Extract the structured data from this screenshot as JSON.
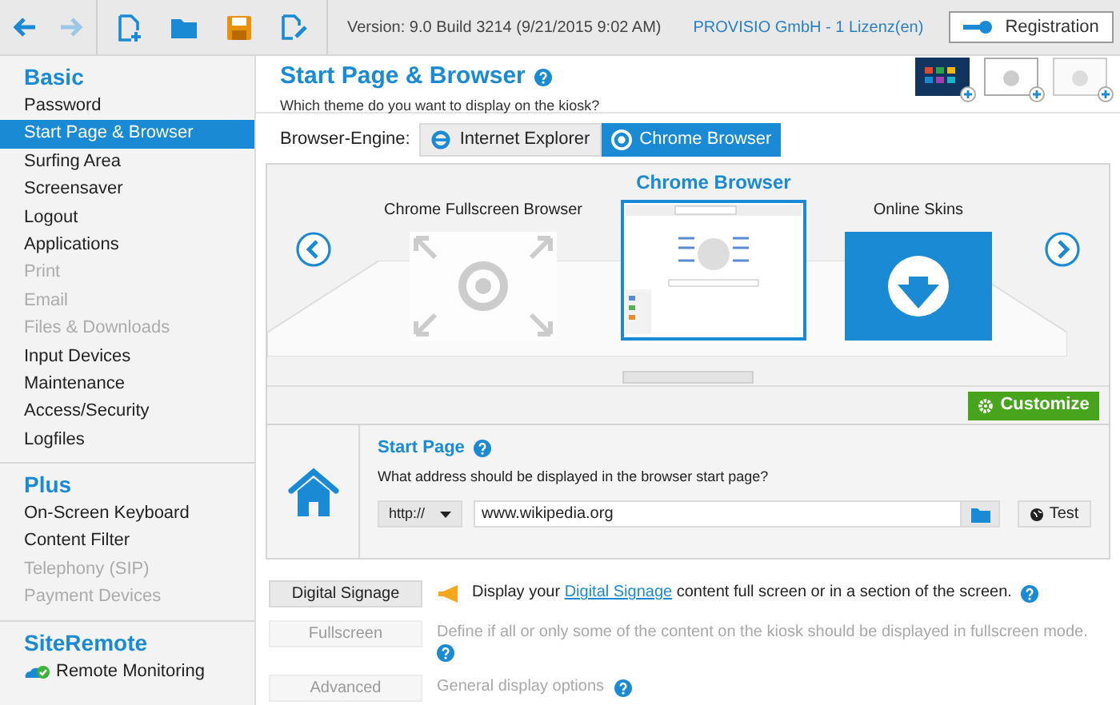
{
  "toolbar": {
    "nav": [
      {
        "kind": "back",
        "disabled": false
      },
      {
        "kind": "forward",
        "disabled": true
      }
    ],
    "version": "Version: 9.0 Build 3214 (9/21/2015 9:02 AM)",
    "license": "PROVISIO GmbH - 1 Lizenz(en)",
    "registration_button": "Registration"
  },
  "sidebar": {
    "sections": [
      {
        "title": "Basic",
        "items": [
          {
            "label": "Password",
            "selected": false,
            "disabled": false
          },
          {
            "label": "Start Page & Browser",
            "selected": true,
            "disabled": false
          },
          {
            "label": "Surfing Area",
            "selected": false,
            "disabled": false
          },
          {
            "label": "Screensaver",
            "selected": false,
            "disabled": false
          },
          {
            "label": "Logout",
            "selected": false,
            "disabled": false
          },
          {
            "label": "Applications",
            "selected": false,
            "disabled": false
          },
          {
            "label": "Print",
            "selected": false,
            "disabled": true
          },
          {
            "label": "Email",
            "selected": false,
            "disabled": true
          },
          {
            "label": "Files & Downloads",
            "selected": false,
            "disabled": true
          },
          {
            "label": "Input Devices",
            "selected": false,
            "disabled": false
          },
          {
            "label": "Maintenance",
            "selected": false,
            "disabled": false
          },
          {
            "label": "Access/Security",
            "selected": false,
            "disabled": false
          },
          {
            "label": "Logfiles",
            "selected": false,
            "disabled": false
          }
        ]
      },
      {
        "title": "Plus",
        "items": [
          {
            "label": "On-Screen Keyboard",
            "selected": false,
            "disabled": false
          },
          {
            "label": "Content Filter",
            "selected": false,
            "disabled": false
          },
          {
            "label": "Telephony (SIP)",
            "selected": false,
            "disabled": true
          },
          {
            "label": "Payment Devices",
            "selected": false,
            "disabled": true
          }
        ]
      },
      {
        "title": "SiteRemote",
        "items": [
          {
            "label": "Remote Monitoring",
            "selected": false,
            "disabled": false,
            "kind": "remote"
          }
        ]
      }
    ]
  },
  "page": {
    "title": "Start Page & Browser",
    "subtitle": "Which theme do you want to display on the kiosk?",
    "engine_label": "Browser-Engine:",
    "engine_tabs": [
      {
        "label": "Internet Explorer",
        "kind": "ie",
        "selected": false
      },
      {
        "label": "Chrome Browser",
        "kind": "chrome",
        "selected": true
      }
    ],
    "carousel": [
      {
        "label": "Chrome Fullscreen Browser",
        "kind": "fullscreen",
        "selected": false
      },
      {
        "label": "Chrome Browser",
        "kind": "browser",
        "selected": true
      },
      {
        "label": "Online Skins",
        "kind": "skins",
        "selected": false
      }
    ],
    "customize_button": "Customize",
    "start_page": {
      "title": "Start Page",
      "question": "What address should be displayed in the browser start page?",
      "protocol": "http://",
      "url": "www.wikipedia.org",
      "test_button": "Test"
    },
    "options": [
      {
        "button": "Digital Signage",
        "disabled": false,
        "text_before": "Display your",
        "link": "Digital Signage",
        "text_after": "content full screen or in a section of the screen."
      },
      {
        "button": "Fullscreen",
        "disabled": true,
        "description": "Define if all or only some of the content on the kiosk should be displayed in fullscreen mode."
      },
      {
        "button": "Advanced",
        "disabled": true,
        "description": "General display options"
      }
    ]
  }
}
